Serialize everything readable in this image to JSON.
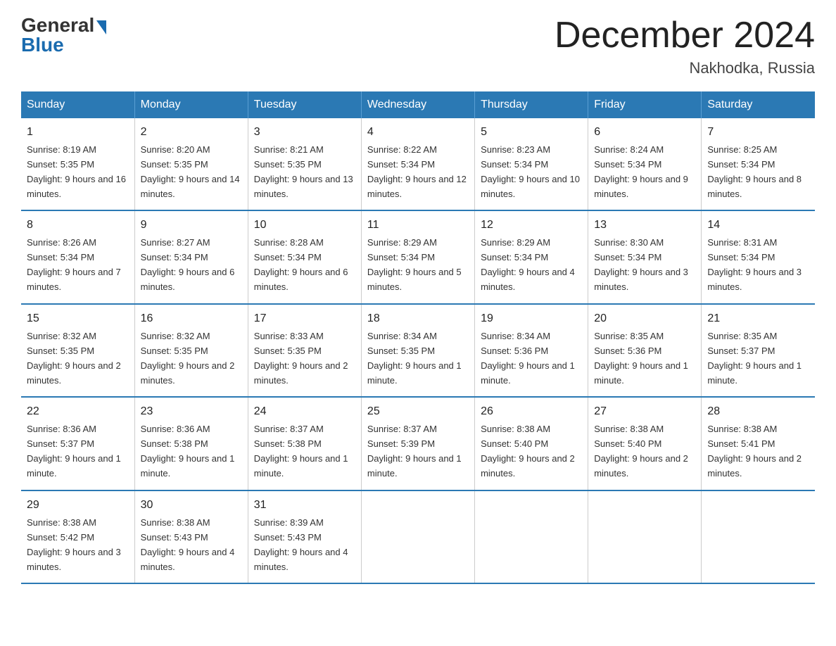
{
  "header": {
    "logo_general": "General",
    "logo_blue": "Blue",
    "month_title": "December 2024",
    "location": "Nakhodka, Russia"
  },
  "days_of_week": [
    "Sunday",
    "Monday",
    "Tuesday",
    "Wednesday",
    "Thursday",
    "Friday",
    "Saturday"
  ],
  "weeks": [
    [
      {
        "day": "1",
        "sunrise": "8:19 AM",
        "sunset": "5:35 PM",
        "daylight": "9 hours and 16 minutes."
      },
      {
        "day": "2",
        "sunrise": "8:20 AM",
        "sunset": "5:35 PM",
        "daylight": "9 hours and 14 minutes."
      },
      {
        "day": "3",
        "sunrise": "8:21 AM",
        "sunset": "5:35 PM",
        "daylight": "9 hours and 13 minutes."
      },
      {
        "day": "4",
        "sunrise": "8:22 AM",
        "sunset": "5:34 PM",
        "daylight": "9 hours and 12 minutes."
      },
      {
        "day": "5",
        "sunrise": "8:23 AM",
        "sunset": "5:34 PM",
        "daylight": "9 hours and 10 minutes."
      },
      {
        "day": "6",
        "sunrise": "8:24 AM",
        "sunset": "5:34 PM",
        "daylight": "9 hours and 9 minutes."
      },
      {
        "day": "7",
        "sunrise": "8:25 AM",
        "sunset": "5:34 PM",
        "daylight": "9 hours and 8 minutes."
      }
    ],
    [
      {
        "day": "8",
        "sunrise": "8:26 AM",
        "sunset": "5:34 PM",
        "daylight": "9 hours and 7 minutes."
      },
      {
        "day": "9",
        "sunrise": "8:27 AM",
        "sunset": "5:34 PM",
        "daylight": "9 hours and 6 minutes."
      },
      {
        "day": "10",
        "sunrise": "8:28 AM",
        "sunset": "5:34 PM",
        "daylight": "9 hours and 6 minutes."
      },
      {
        "day": "11",
        "sunrise": "8:29 AM",
        "sunset": "5:34 PM",
        "daylight": "9 hours and 5 minutes."
      },
      {
        "day": "12",
        "sunrise": "8:29 AM",
        "sunset": "5:34 PM",
        "daylight": "9 hours and 4 minutes."
      },
      {
        "day": "13",
        "sunrise": "8:30 AM",
        "sunset": "5:34 PM",
        "daylight": "9 hours and 3 minutes."
      },
      {
        "day": "14",
        "sunrise": "8:31 AM",
        "sunset": "5:34 PM",
        "daylight": "9 hours and 3 minutes."
      }
    ],
    [
      {
        "day": "15",
        "sunrise": "8:32 AM",
        "sunset": "5:35 PM",
        "daylight": "9 hours and 2 minutes."
      },
      {
        "day": "16",
        "sunrise": "8:32 AM",
        "sunset": "5:35 PM",
        "daylight": "9 hours and 2 minutes."
      },
      {
        "day": "17",
        "sunrise": "8:33 AM",
        "sunset": "5:35 PM",
        "daylight": "9 hours and 2 minutes."
      },
      {
        "day": "18",
        "sunrise": "8:34 AM",
        "sunset": "5:35 PM",
        "daylight": "9 hours and 1 minute."
      },
      {
        "day": "19",
        "sunrise": "8:34 AM",
        "sunset": "5:36 PM",
        "daylight": "9 hours and 1 minute."
      },
      {
        "day": "20",
        "sunrise": "8:35 AM",
        "sunset": "5:36 PM",
        "daylight": "9 hours and 1 minute."
      },
      {
        "day": "21",
        "sunrise": "8:35 AM",
        "sunset": "5:37 PM",
        "daylight": "9 hours and 1 minute."
      }
    ],
    [
      {
        "day": "22",
        "sunrise": "8:36 AM",
        "sunset": "5:37 PM",
        "daylight": "9 hours and 1 minute."
      },
      {
        "day": "23",
        "sunrise": "8:36 AM",
        "sunset": "5:38 PM",
        "daylight": "9 hours and 1 minute."
      },
      {
        "day": "24",
        "sunrise": "8:37 AM",
        "sunset": "5:38 PM",
        "daylight": "9 hours and 1 minute."
      },
      {
        "day": "25",
        "sunrise": "8:37 AM",
        "sunset": "5:39 PM",
        "daylight": "9 hours and 1 minute."
      },
      {
        "day": "26",
        "sunrise": "8:38 AM",
        "sunset": "5:40 PM",
        "daylight": "9 hours and 2 minutes."
      },
      {
        "day": "27",
        "sunrise": "8:38 AM",
        "sunset": "5:40 PM",
        "daylight": "9 hours and 2 minutes."
      },
      {
        "day": "28",
        "sunrise": "8:38 AM",
        "sunset": "5:41 PM",
        "daylight": "9 hours and 2 minutes."
      }
    ],
    [
      {
        "day": "29",
        "sunrise": "8:38 AM",
        "sunset": "5:42 PM",
        "daylight": "9 hours and 3 minutes."
      },
      {
        "day": "30",
        "sunrise": "8:38 AM",
        "sunset": "5:43 PM",
        "daylight": "9 hours and 4 minutes."
      },
      {
        "day": "31",
        "sunrise": "8:39 AM",
        "sunset": "5:43 PM",
        "daylight": "9 hours and 4 minutes."
      },
      {
        "day": "",
        "sunrise": "",
        "sunset": "",
        "daylight": ""
      },
      {
        "day": "",
        "sunrise": "",
        "sunset": "",
        "daylight": ""
      },
      {
        "day": "",
        "sunrise": "",
        "sunset": "",
        "daylight": ""
      },
      {
        "day": "",
        "sunrise": "",
        "sunset": "",
        "daylight": ""
      }
    ]
  ],
  "labels": {
    "sunrise_prefix": "Sunrise: ",
    "sunset_prefix": "Sunset: ",
    "daylight_prefix": "Daylight: "
  }
}
